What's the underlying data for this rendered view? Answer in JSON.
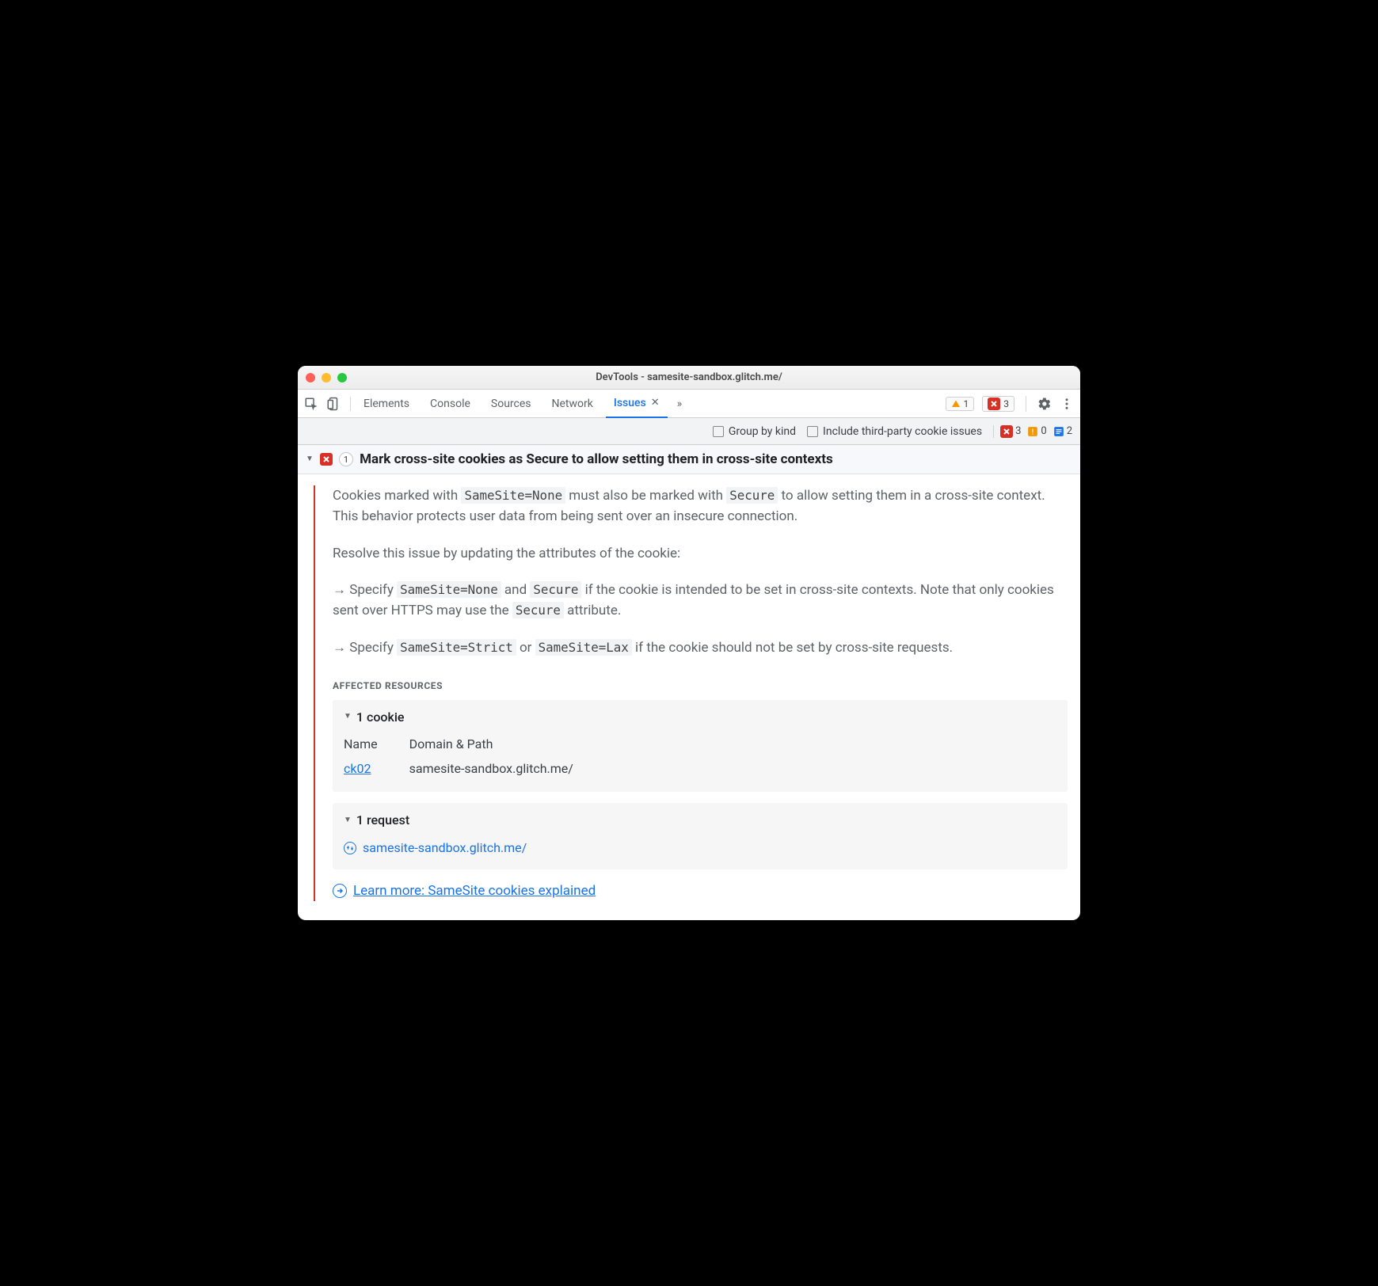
{
  "window": {
    "title": "DevTools - samesite-sandbox.glitch.me/"
  },
  "tabs": {
    "items": [
      "Elements",
      "Console",
      "Sources",
      "Network"
    ],
    "active": {
      "label": "Issues"
    }
  },
  "toolbar": {
    "warning_count": "1",
    "error_count": "3"
  },
  "options": {
    "group_by_kind": "Group by kind",
    "include_thirdparty": "Include third-party cookie issues",
    "err": "3",
    "warn": "0",
    "info": "2"
  },
  "issue": {
    "count": "1",
    "title": "Mark cross-site cookies as Secure to allow setting them in cross-site contexts",
    "para1_pre": "Cookies marked with ",
    "code1": "SameSite=None",
    "para1_mid": " must also be marked with ",
    "code2": "Secure",
    "para1_post": " to allow setting them in a cross-site context. This behavior protects user data from being sent over an insecure connection.",
    "para2": "Resolve this issue by updating the attributes of the cookie:",
    "b1_pre": "Specify ",
    "b1_c1": "SameSite=None",
    "b1_mid": " and ",
    "b1_c2": "Secure",
    "b1_post1": " if the cookie is intended to be set in cross-site contexts. Note that only cookies sent over HTTPS may use the ",
    "b1_c3": "Secure",
    "b1_post2": " attribute.",
    "b2_pre": "Specify ",
    "b2_c1": "SameSite=Strict",
    "b2_mid": " or ",
    "b2_c2": "SameSite=Lax",
    "b2_post": " if the cookie should not be set by cross-site requests."
  },
  "affected": {
    "header": "Affected Resources",
    "cookies": {
      "title": "1 cookie",
      "col_name": "Name",
      "col_domain": "Domain & Path",
      "row_name": "ck02",
      "row_domain": "samesite-sandbox.glitch.me/"
    },
    "requests": {
      "title": "1 request",
      "url": "samesite-sandbox.glitch.me/"
    }
  },
  "learn_more": "Learn more: SameSite cookies explained"
}
